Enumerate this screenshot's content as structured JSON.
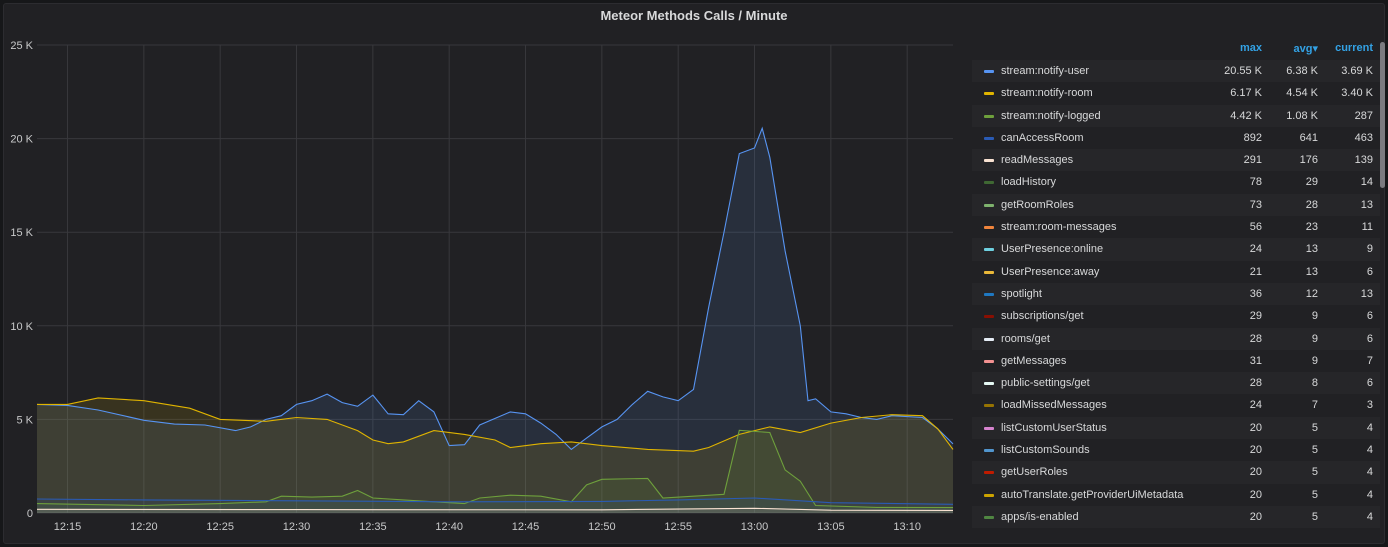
{
  "panel": {
    "title": "Meteor Methods Calls / Minute"
  },
  "legend": {
    "columns": {
      "max": "max",
      "avg": "avg▾",
      "current": "current"
    },
    "rows": [
      {
        "name": "stream:notify-user",
        "color": "#5794f2",
        "max": "20.55 K",
        "avg": "6.38 K",
        "current": "3.69 K"
      },
      {
        "name": "stream:notify-room",
        "color": "#e0b400",
        "max": "6.17 K",
        "avg": "4.54 K",
        "current": "3.40 K"
      },
      {
        "name": "stream:notify-logged",
        "color": "#6ea03c",
        "max": "4.42 K",
        "avg": "1.08 K",
        "current": "287"
      },
      {
        "name": "canAccessRoom",
        "color": "#2a5bb5",
        "max": "892",
        "avg": "641",
        "current": "463"
      },
      {
        "name": "readMessages",
        "color": "#f9e2d2",
        "max": "291",
        "avg": "176",
        "current": "139"
      },
      {
        "name": "loadHistory",
        "color": "#3f6833",
        "max": "78",
        "avg": "29",
        "current": "14"
      },
      {
        "name": "getRoomRoles",
        "color": "#7eb26d",
        "max": "73",
        "avg": "28",
        "current": "13"
      },
      {
        "name": "stream:room-messages",
        "color": "#ef843c",
        "max": "56",
        "avg": "23",
        "current": "11"
      },
      {
        "name": "UserPresence:online",
        "color": "#6ed0e0",
        "max": "24",
        "avg": "13",
        "current": "9"
      },
      {
        "name": "UserPresence:away",
        "color": "#eab839",
        "max": "21",
        "avg": "13",
        "current": "6"
      },
      {
        "name": "spotlight",
        "color": "#1f78c1",
        "max": "36",
        "avg": "12",
        "current": "13"
      },
      {
        "name": "subscriptions/get",
        "color": "#890f02",
        "max": "29",
        "avg": "9",
        "current": "6"
      },
      {
        "name": "rooms/get",
        "color": "#e5ecf5",
        "max": "28",
        "avg": "9",
        "current": "6"
      },
      {
        "name": "getMessages",
        "color": "#f29191",
        "max": "31",
        "avg": "9",
        "current": "7"
      },
      {
        "name": "public-settings/get",
        "color": "#e5f8f3",
        "max": "28",
        "avg": "8",
        "current": "6"
      },
      {
        "name": "loadMissedMessages",
        "color": "#967302",
        "max": "24",
        "avg": "7",
        "current": "3"
      },
      {
        "name": "listCustomUserStatus",
        "color": "#d683ce",
        "max": "20",
        "avg": "5",
        "current": "4"
      },
      {
        "name": "listCustomSounds",
        "color": "#5195ce",
        "max": "20",
        "avg": "5",
        "current": "4"
      },
      {
        "name": "getUserRoles",
        "color": "#bf1b00",
        "max": "20",
        "avg": "5",
        "current": "4"
      },
      {
        "name": "autoTranslate.getProviderUiMetadata",
        "color": "#cca300",
        "max": "20",
        "avg": "5",
        "current": "4"
      },
      {
        "name": "apps/is-enabled",
        "color": "#508642",
        "max": "20",
        "avg": "5",
        "current": "4"
      }
    ]
  },
  "chart_data": {
    "type": "area",
    "title": "Meteor Methods Calls / Minute",
    "xlabel": "",
    "ylabel": "",
    "ylim": [
      0,
      25000
    ],
    "y_ticks": [
      0,
      5000,
      10000,
      15000,
      20000,
      25000
    ],
    "y_tick_labels": [
      "0",
      "5 K",
      "10 K",
      "15 K",
      "20 K",
      "25 K"
    ],
    "x_range": [
      "12:13",
      "13:13"
    ],
    "x_tick_labels": [
      "12:15",
      "12:20",
      "12:25",
      "12:30",
      "12:35",
      "12:40",
      "12:45",
      "12:50",
      "12:55",
      "13:00",
      "13:05",
      "13:10"
    ],
    "grid": true,
    "legend_placement": "right",
    "series": [
      {
        "name": "stream:notify-user",
        "color": "#5794f2",
        "points": [
          [
            "12:13",
            5800
          ],
          [
            "12:15",
            5750
          ],
          [
            "12:17",
            5500
          ],
          [
            "12:20",
            4950
          ],
          [
            "12:22",
            4750
          ],
          [
            "12:24",
            4700
          ],
          [
            "12:26",
            4400
          ],
          [
            "12:27",
            4600
          ],
          [
            "12:28",
            5000
          ],
          [
            "12:29",
            5200
          ],
          [
            "12:30",
            5800
          ],
          [
            "12:31",
            6000
          ],
          [
            "12:32",
            6350
          ],
          [
            "12:33",
            5900
          ],
          [
            "12:34",
            5700
          ],
          [
            "12:35",
            6300
          ],
          [
            "12:36",
            5300
          ],
          [
            "12:37",
            5250
          ],
          [
            "12:38",
            6000
          ],
          [
            "12:39",
            5400
          ],
          [
            "12:40",
            3600
          ],
          [
            "12:41",
            3650
          ],
          [
            "12:42",
            4700
          ],
          [
            "12:44",
            5400
          ],
          [
            "12:45",
            5300
          ],
          [
            "12:46",
            4800
          ],
          [
            "12:47",
            4200
          ],
          [
            "12:48",
            3400
          ],
          [
            "12:49",
            4000
          ],
          [
            "12:50",
            4600
          ],
          [
            "12:51",
            5000
          ],
          [
            "12:52",
            5800
          ],
          [
            "12:53",
            6500
          ],
          [
            "12:54",
            6200
          ],
          [
            "12:55",
            6000
          ],
          [
            "12:56",
            6600
          ],
          [
            "12:57",
            11000
          ],
          [
            "12:58",
            15000
          ],
          [
            "12:59",
            19200
          ],
          [
            "13:00",
            19500
          ],
          [
            "13:00:30",
            20550
          ],
          [
            "13:01",
            19000
          ],
          [
            "13:02",
            14000
          ],
          [
            "13:03",
            10000
          ],
          [
            "13:03:30",
            6000
          ],
          [
            "13:04",
            6100
          ],
          [
            "13:05",
            5400
          ],
          [
            "13:06",
            5300
          ],
          [
            "13:07",
            5100
          ],
          [
            "13:08",
            5000
          ],
          [
            "13:09",
            5200
          ],
          [
            "13:11",
            5100
          ],
          [
            "13:12",
            4500
          ],
          [
            "13:13",
            3690
          ]
        ]
      },
      {
        "name": "stream:notify-room",
        "color": "#e0b400",
        "points": [
          [
            "12:13",
            5800
          ],
          [
            "12:15",
            5800
          ],
          [
            "12:17",
            6150
          ],
          [
            "12:20",
            6000
          ],
          [
            "12:23",
            5600
          ],
          [
            "12:25",
            5000
          ],
          [
            "12:28",
            4900
          ],
          [
            "12:30",
            5100
          ],
          [
            "12:32",
            5000
          ],
          [
            "12:34",
            4400
          ],
          [
            "12:35",
            3900
          ],
          [
            "12:36",
            3700
          ],
          [
            "12:37",
            3800
          ],
          [
            "12:39",
            4400
          ],
          [
            "12:41",
            4200
          ],
          [
            "12:43",
            3900
          ],
          [
            "12:44",
            3500
          ],
          [
            "12:46",
            3700
          ],
          [
            "12:48",
            3800
          ],
          [
            "12:50",
            3600
          ],
          [
            "12:53",
            3400
          ],
          [
            "12:56",
            3300
          ],
          [
            "12:57",
            3500
          ],
          [
            "12:59",
            4200
          ],
          [
            "13:01",
            4600
          ],
          [
            "13:03",
            4300
          ],
          [
            "13:05",
            4800
          ],
          [
            "13:07",
            5100
          ],
          [
            "13:09",
            5250
          ],
          [
            "13:11",
            5200
          ],
          [
            "13:12",
            4500
          ],
          [
            "13:13",
            3400
          ]
        ]
      },
      {
        "name": "stream:notify-logged",
        "color": "#6ea03c",
        "points": [
          [
            "12:13",
            500
          ],
          [
            "12:20",
            400
          ],
          [
            "12:25",
            500
          ],
          [
            "12:28",
            600
          ],
          [
            "12:29",
            900
          ],
          [
            "12:31",
            850
          ],
          [
            "12:33",
            900
          ],
          [
            "12:34",
            1200
          ],
          [
            "12:35",
            800
          ],
          [
            "12:37",
            700
          ],
          [
            "12:39",
            600
          ],
          [
            "12:41",
            500
          ],
          [
            "12:42",
            800
          ],
          [
            "12:44",
            950
          ],
          [
            "12:46",
            900
          ],
          [
            "12:48",
            600
          ],
          [
            "12:49",
            1500
          ],
          [
            "12:50",
            1800
          ],
          [
            "12:53",
            1850
          ],
          [
            "12:54",
            800
          ],
          [
            "12:56",
            900
          ],
          [
            "12:58",
            1000
          ],
          [
            "12:59",
            4420
          ],
          [
            "13:01",
            4300
          ],
          [
            "13:02",
            2300
          ],
          [
            "13:03",
            1700
          ],
          [
            "13:04",
            400
          ],
          [
            "13:08",
            300
          ],
          [
            "13:13",
            287
          ]
        ]
      },
      {
        "name": "canAccessRoom",
        "color": "#2a5bb5",
        "points": [
          [
            "12:13",
            750
          ],
          [
            "12:20",
            700
          ],
          [
            "12:30",
            650
          ],
          [
            "12:40",
            600
          ],
          [
            "12:50",
            620
          ],
          [
            "12:55",
            700
          ],
          [
            "13:00",
            800
          ],
          [
            "13:05",
            550
          ],
          [
            "13:13",
            463
          ]
        ]
      },
      {
        "name": "readMessages",
        "color": "#f9e2d2",
        "points": [
          [
            "12:13",
            200
          ],
          [
            "12:30",
            180
          ],
          [
            "12:50",
            170
          ],
          [
            "13:00",
            250
          ],
          [
            "13:05",
            150
          ],
          [
            "13:13",
            139
          ]
        ]
      }
    ]
  }
}
